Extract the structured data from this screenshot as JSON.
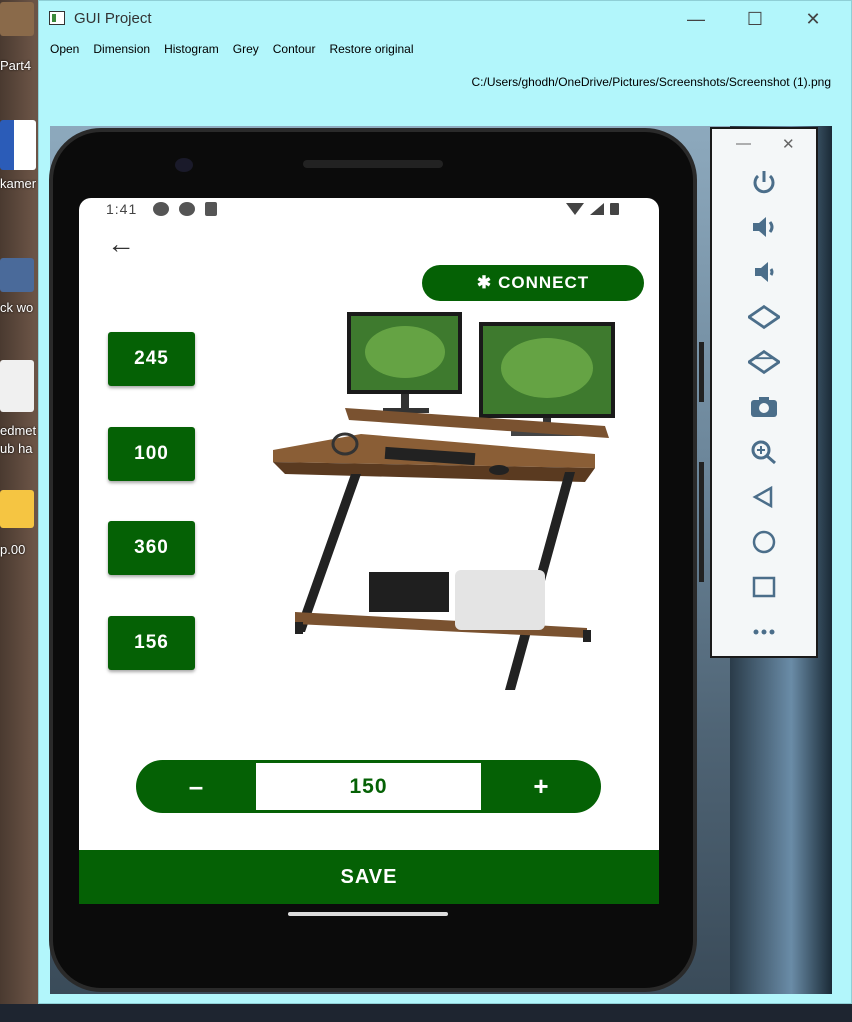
{
  "window": {
    "title": "GUI Project",
    "minimize": "—",
    "maximize": "☐",
    "close": "✕"
  },
  "menu": [
    "Open",
    "Dimension",
    "Histogram",
    "Grey",
    "Contour",
    "Restore original"
  ],
  "file_path": "C:/Users/ghodh/OneDrive/Pictures/Screenshots/Screenshot (1).png",
  "desktop_icons": [
    {
      "label": "Part4",
      "icon": "sketchup-file-icon"
    },
    {
      "label": "kamer",
      "icon": "word-document-icon"
    },
    {
      "label": "ck wo",
      "icon": "sketchup-file-icon"
    },
    {
      "label": "edmet\nub ha",
      "icon": "vscode-file-icon"
    },
    {
      "label": "p.00",
      "icon": "folder-icon"
    }
  ],
  "phone": {
    "status_time": "1:41",
    "back_icon": "←",
    "connect_label": "CONNECT",
    "bluetooth_icon": "✱",
    "preset_values": [
      "245",
      "100",
      "360",
      "156"
    ],
    "stepper": {
      "minus": "–",
      "value": "150",
      "plus": "+"
    },
    "save_label": "SAVE"
  },
  "emulator_toolbar": {
    "minimize": "—",
    "close": "✕",
    "icons": [
      "power-icon",
      "volume-up-icon",
      "volume-down-icon",
      "rotate-left-icon",
      "rotate-right-icon",
      "camera-icon",
      "zoom-icon",
      "back-icon",
      "home-icon",
      "overview-icon",
      "more-icon"
    ]
  }
}
